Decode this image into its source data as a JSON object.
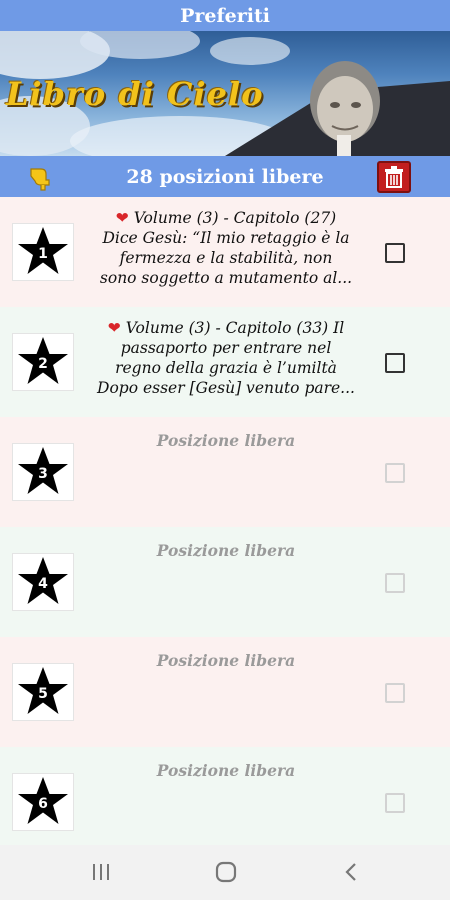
{
  "header": {
    "title": "Preferiti"
  },
  "banner": {
    "title": "Libro di Cielo"
  },
  "toolbar": {
    "free_positions": "28 posizioni libere"
  },
  "entries": [
    {
      "number": "1",
      "lines": [
        "Volume (3) - Capitolo (27)",
        "Dice Gesù: “Il mio retaggio è la",
        "fermezza e la stabilità, non",
        "sono soggetto a mutamento al..."
      ],
      "checked": false
    },
    {
      "number": "2",
      "lines": [
        "Volume (3) - Capitolo (33)  Il",
        "passaporto per entrare nel",
        "regno della grazia è l’umiltà",
        "Dopo esser [Gesù] venuto pare..."
      ],
      "checked": false
    },
    {
      "number": "3",
      "label": "Posizione libera"
    },
    {
      "number": "4",
      "label": "Posizione libera"
    },
    {
      "number": "5",
      "label": "Posizione libera"
    },
    {
      "number": "6",
      "label": "Posizione libera"
    }
  ],
  "icons": {
    "toolbar_left": "pointing-hand-icon",
    "toolbar_right": "trash-icon",
    "favorite": "heart-icon",
    "slot": "star-icon",
    "nav": [
      "recent-apps-icon",
      "home-icon",
      "back-icon"
    ]
  },
  "colors": {
    "bar": "#6f9ae6",
    "heart": "#d9262a",
    "trash": "#c21f1f",
    "banner_text": "#f2c21c",
    "row_pink": "#fcf1f0",
    "row_green": "#f1f8f3"
  }
}
